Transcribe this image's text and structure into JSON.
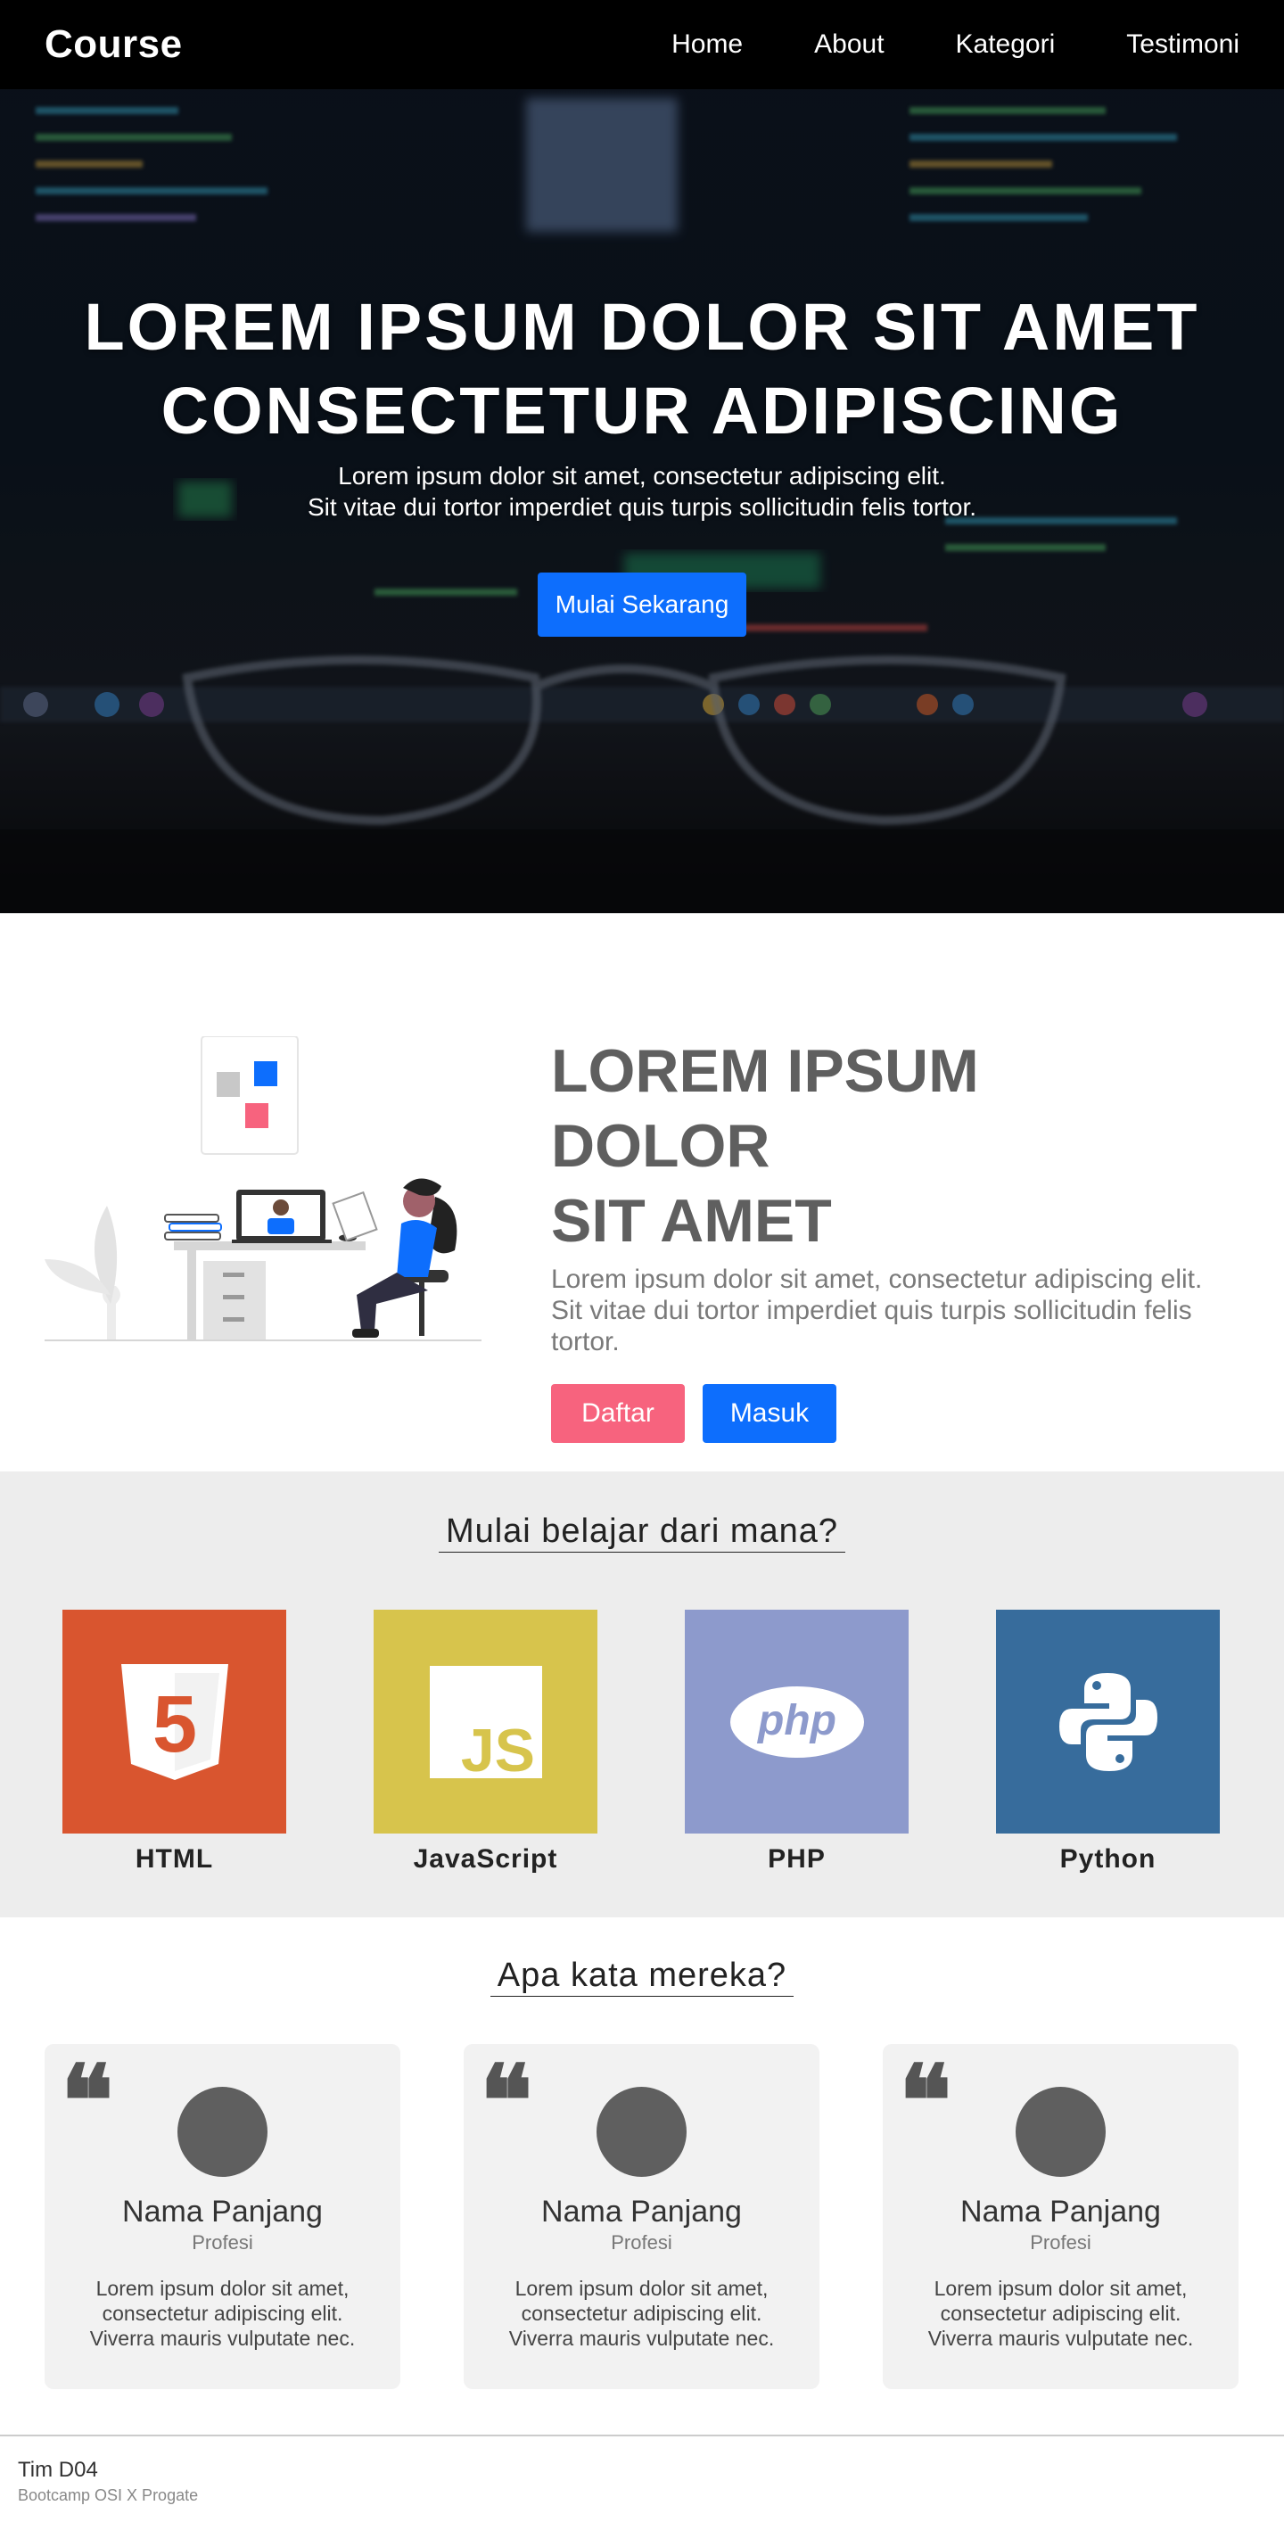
{
  "nav": {
    "brand": "Course",
    "links": [
      "Home",
      "About",
      "Kategori",
      "Testimoni"
    ]
  },
  "hero": {
    "title_line1": "LOREM IPSUM DOLOR SIT AMET",
    "title_line2": "CONSECTETUR ADIPISCING",
    "subtitle_line1": "Lorem ipsum dolor sit amet, consectetur adipiscing elit.",
    "subtitle_line2": "Sit vitae dui tortor imperdiet quis turpis sollicitudin felis tortor.",
    "button": "Mulai Sekarang"
  },
  "about": {
    "title_line1": "LOREM IPSUM DOLOR",
    "title_line2": "SIT AMET",
    "description": "Lorem ipsum dolor sit amet, consectetur adipiscing elit. Sit vitae dui tortor imperdiet quis turpis sollicitudin felis tortor.",
    "btn_register": "Daftar",
    "btn_login": "Masuk"
  },
  "categories": {
    "title": "Mulai belajar dari mana?",
    "items": [
      {
        "label": "HTML",
        "color": "#d9552f"
      },
      {
        "label": "JavaScript",
        "color": "#d7c44c"
      },
      {
        "label": "PHP",
        "color": "#8d9acc"
      },
      {
        "label": "Python",
        "color": "#376c9c"
      }
    ]
  },
  "testimonials": {
    "title": "Apa kata mereka?",
    "items": [
      {
        "name": "Nama Panjang",
        "role": "Profesi",
        "text": "Lorem ipsum dolor sit amet, consectetur adipiscing elit. Viverra mauris vulputate nec."
      },
      {
        "name": "Nama Panjang",
        "role": "Profesi",
        "text": "Lorem ipsum dolor sit amet, consectetur adipiscing elit. Viverra mauris vulputate nec."
      },
      {
        "name": "Nama Panjang",
        "role": "Profesi",
        "text": "Lorem ipsum dolor sit amet, consectetur adipiscing elit. Viverra mauris vulputate nec."
      }
    ]
  },
  "footer": {
    "team": "Tim D04",
    "subtitle": "Bootcamp OSI X Progate"
  },
  "colors": {
    "primary": "#0d6efd",
    "pink": "#f7637e",
    "heading_gray": "#5f5f5f",
    "section_bg": "#ededed"
  }
}
